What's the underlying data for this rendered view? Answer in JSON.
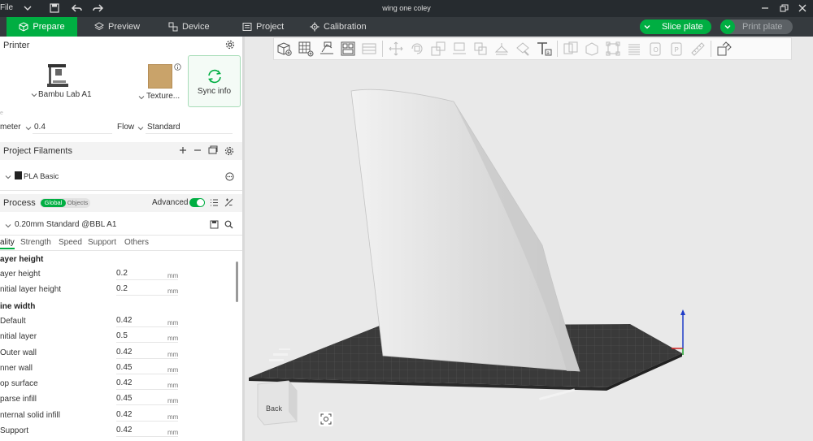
{
  "titlebar": {
    "file_label": "File",
    "title": "wing one coley"
  },
  "nav": {
    "tabs": [
      {
        "label": "Prepare",
        "icon": "cube-icon",
        "active": true
      },
      {
        "label": "Preview",
        "icon": "layers-icon",
        "active": false
      },
      {
        "label": "Device",
        "icon": "device-icon",
        "active": false
      },
      {
        "label": "Project",
        "icon": "project-icon",
        "active": false
      },
      {
        "label": "Calibration",
        "icon": "calibration-icon",
        "active": false
      }
    ],
    "slice_label": "Slice plate",
    "print_label": "Print plate",
    "accent": "#00ae42"
  },
  "printer": {
    "section_title": "Printer",
    "printer_name": "Bambu Lab A1",
    "plate_name": "Texture...",
    "sync_label": "Sync info",
    "diameter_label": "meter",
    "diameter_value": "0.4",
    "flow_label": "Flow",
    "flow_value": "Standard"
  },
  "filaments": {
    "section_title": "Project Filaments",
    "items": [
      {
        "name": "PLA Basic"
      }
    ]
  },
  "process": {
    "section_title": "Process",
    "toggle_global": "Global",
    "toggle_objects": "Objects",
    "advanced_label": "Advanced",
    "preset_name": "0.20mm Standard @BBL A1",
    "tabs": [
      "ality",
      "Strength",
      "Speed",
      "Support",
      "Others"
    ],
    "groups": [
      {
        "title": "ayer height",
        "params": [
          {
            "label": "ayer height",
            "value": "0.2",
            "unit": "mm"
          },
          {
            "label": "nitial layer height",
            "value": "0.2",
            "unit": "mm"
          }
        ]
      },
      {
        "title": "ine width",
        "params": [
          {
            "label": "Default",
            "value": "0.42",
            "unit": "mm"
          },
          {
            "label": "nitial layer",
            "value": "0.5",
            "unit": "mm"
          },
          {
            "label": "Outer wall",
            "value": "0.42",
            "unit": "mm"
          },
          {
            "label": "nner wall",
            "value": "0.45",
            "unit": "mm"
          },
          {
            "label": "op surface",
            "value": "0.42",
            "unit": "mm"
          },
          {
            "label": "parse infill",
            "value": "0.45",
            "unit": "mm"
          },
          {
            "label": "nternal solid infill",
            "value": "0.42",
            "unit": "mm"
          },
          {
            "label": "Support",
            "value": "0.42",
            "unit": "mm"
          }
        ]
      }
    ]
  },
  "viewport": {
    "view_cube_label": "Back",
    "toolbar_icons": [
      "add-object-icon",
      "plate-grid-icon",
      "auto-orient-icon",
      "arrange-icon",
      "plate-layout-icon",
      "move-icon",
      "rotate-icon",
      "scale-icon",
      "lay-on-face-icon",
      "cut-icon",
      "support-paint-icon",
      "seam-paint-icon",
      "text-icon",
      "mesh-boolean-icon",
      "measure-icon",
      "assembly-icon",
      "variable-layer-icon",
      "part-icon",
      "place-icon",
      "ruler-icon",
      "explode-icon"
    ]
  }
}
